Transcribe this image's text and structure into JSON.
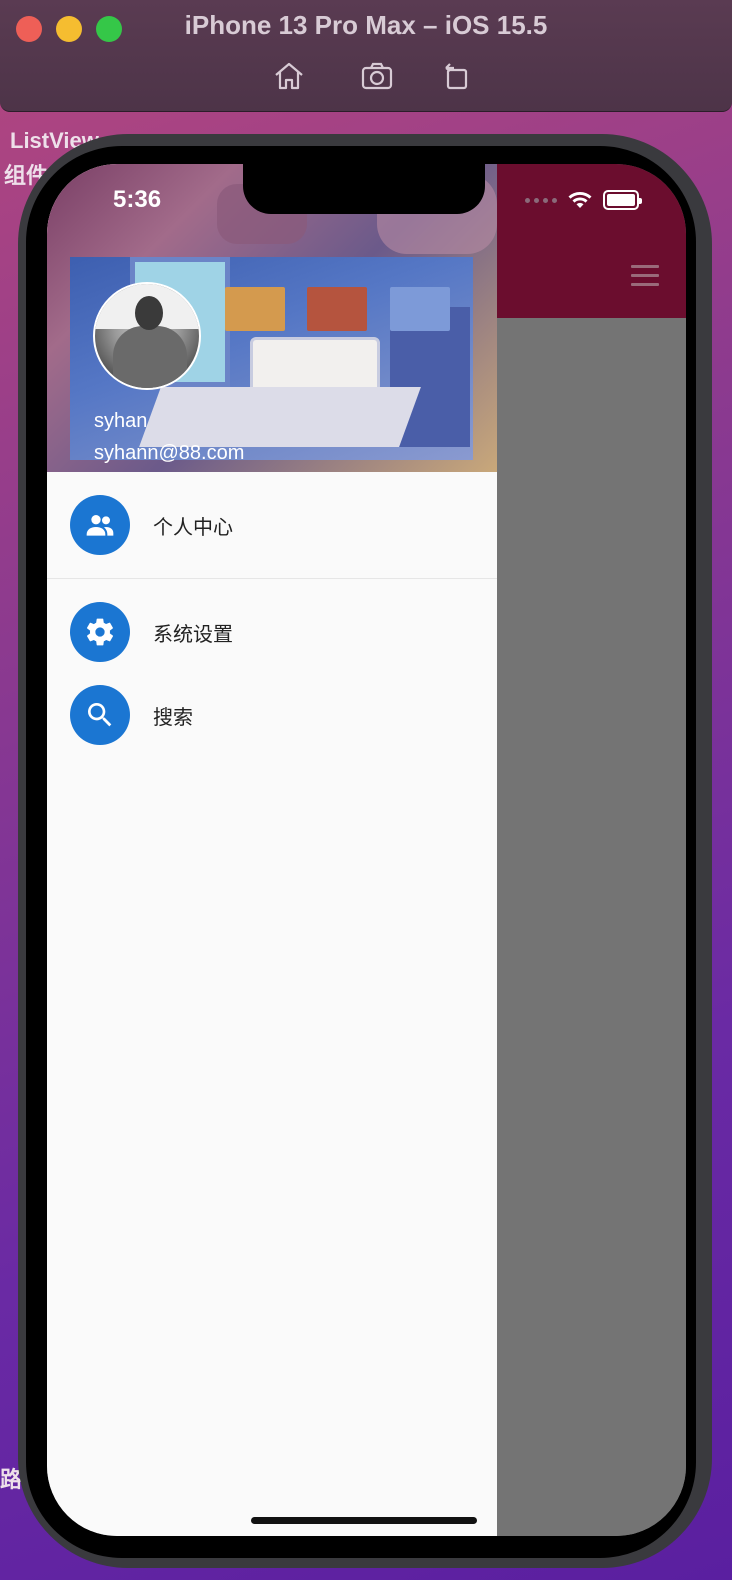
{
  "simulator": {
    "title": "iPhone 13 Pro Max – iOS 15.5",
    "toolbar_icons": [
      "home-icon",
      "screenshot-icon",
      "rotate-icon"
    ]
  },
  "desktop_text": {
    "line1": "ListView",
    "line2": "组件",
    "line3": "路"
  },
  "status_bar": {
    "time": "5:36"
  },
  "drawer": {
    "account_name": "syhan",
    "account_email": "syhann@88.com",
    "items": [
      {
        "label": "个人中心",
        "icon": "people-icon"
      },
      {
        "label": "系统设置",
        "icon": "settings-icon"
      },
      {
        "label": "搜索",
        "icon": "search-icon"
      }
    ]
  },
  "colors": {
    "appbar": "#6b0d2e",
    "accent": "#1b76d2",
    "drawer_bg": "#fafafa",
    "scrim": "#747474"
  }
}
